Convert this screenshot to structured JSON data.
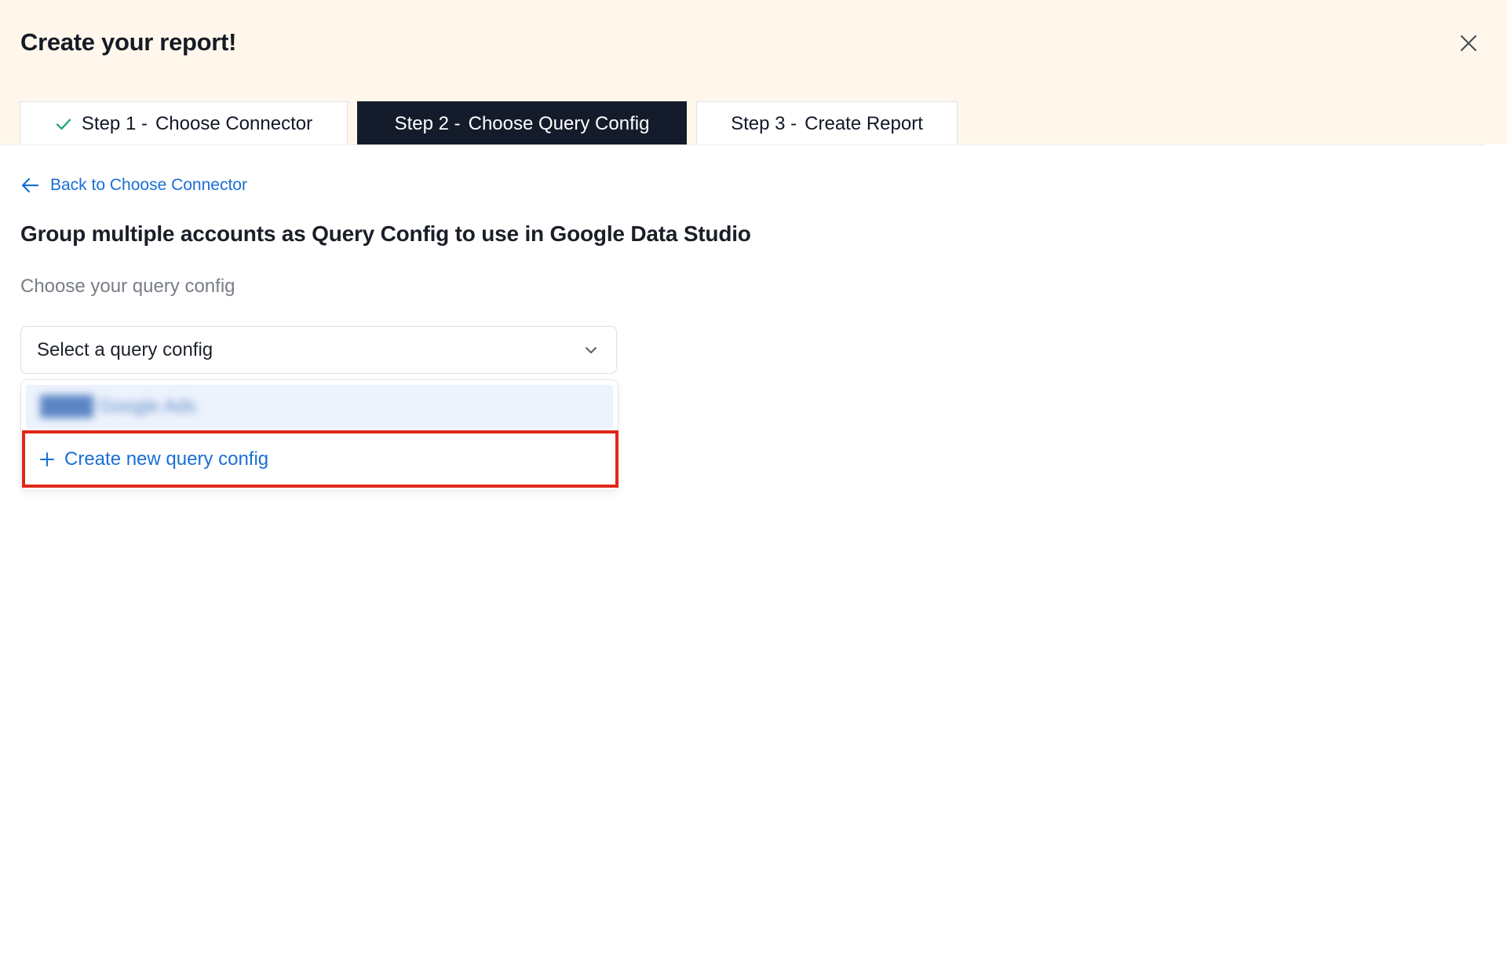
{
  "header": {
    "title": "Create your report!",
    "close_icon": "close-icon",
    "background": "#fff7ec"
  },
  "steps": [
    {
      "number": "Step 1 -",
      "name": "Choose Connector",
      "state": "completed",
      "icon": "check-icon"
    },
    {
      "number": "Step 2 -",
      "name": "Choose Query Config",
      "state": "active"
    },
    {
      "number": "Step 3 -",
      "name": "Create Report",
      "state": "upcoming"
    }
  ],
  "back_link": {
    "label": "Back to Choose Connector",
    "icon": "arrow-left-icon"
  },
  "main": {
    "heading": "Group multiple accounts as Query Config to use in Google Data Studio",
    "field_label": "Choose your query config"
  },
  "select": {
    "placeholder": "Select a query config",
    "icon": "chevron-down-icon"
  },
  "dropdown": {
    "options": [
      {
        "label": "████ Google Ads"
      }
    ],
    "create_new_label": "Create new query config",
    "create_new_icon": "plus-icon"
  },
  "colors": {
    "accent_link": "#1a6fd6",
    "active_tab": "#141c2b",
    "highlight_border": "#e0261a",
    "check": "#1aa370"
  }
}
